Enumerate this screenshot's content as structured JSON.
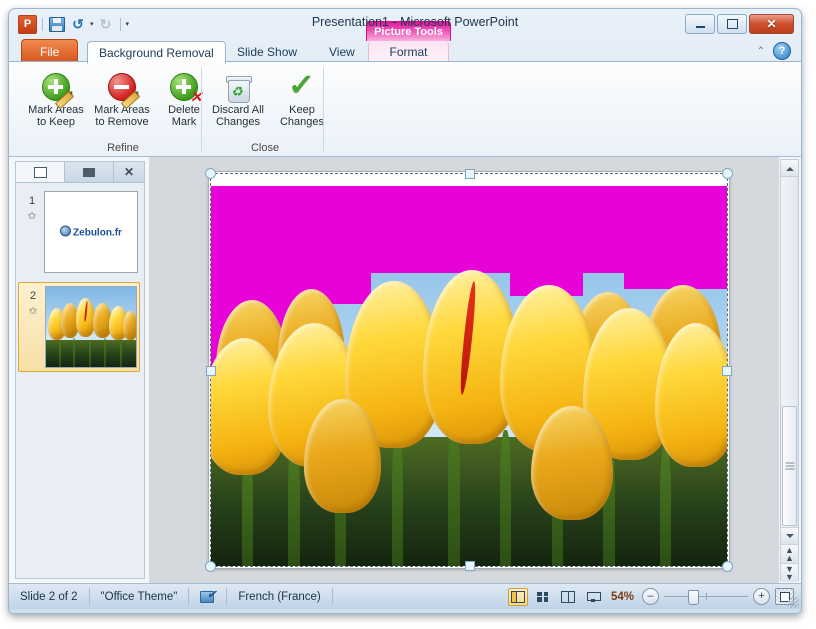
{
  "window": {
    "title": "Presentation1  -  Microsoft PowerPoint",
    "contextual_tab": "Picture Tools",
    "minimize": "–",
    "maximize": "□",
    "close": "✕"
  },
  "quick_access": {
    "app_logo": "P",
    "save": "save-icon",
    "undo": "↺",
    "undo_dropdown": "▾",
    "redo": "↻",
    "customize": "▾"
  },
  "help": {
    "collapse_ribbon": "⌃",
    "help": "?"
  },
  "tabs": [
    {
      "label": "File",
      "active": false
    },
    {
      "label": "Background Removal",
      "active": true
    },
    {
      "label": "Slide Show",
      "active": false
    },
    {
      "label": "View",
      "active": false
    },
    {
      "label": "Format",
      "active": false
    }
  ],
  "ribbon": {
    "groups": [
      {
        "label": "Refine",
        "buttons": [
          {
            "label_line1": "Mark Areas",
            "label_line2": "to Keep",
            "icon": "mark-keep-icon"
          },
          {
            "label_line1": "Mark Areas",
            "label_line2": "to Remove",
            "icon": "mark-remove-icon"
          },
          {
            "label_line1": "Delete",
            "label_line2": "Mark",
            "icon": "delete-mark-icon"
          }
        ]
      },
      {
        "label": "Close",
        "buttons": [
          {
            "label_line1": "Discard All",
            "label_line2": "Changes",
            "icon": "recycle-bin-icon"
          },
          {
            "label_line1": "Keep",
            "label_line2": "Changes",
            "icon": "checkmark-icon"
          }
        ]
      }
    ]
  },
  "slide_pane": {
    "tab_slides": "slides-tab-icon",
    "tab_outline": "outline-tab-icon",
    "close": "✕",
    "slides": [
      {
        "number": "1",
        "star": "✩",
        "selected": false,
        "content": "Zebulon.fr"
      },
      {
        "number": "2",
        "star": "✩",
        "selected": true,
        "content": "tulips-image"
      }
    ]
  },
  "canvas": {
    "selection": "picture-selected",
    "removal_color": "#e602d9"
  },
  "scrollbar": {
    "up": "▲",
    "down": "▼",
    "previous_slide": "▲",
    "next_slide": "▼"
  },
  "status": {
    "slide_counter": "Slide 2 of 2",
    "theme": "\"Office Theme\"",
    "spellcheck": "spellcheck-icon",
    "language": "French (France)",
    "views": [
      {
        "name": "Normal",
        "active": true
      },
      {
        "name": "Slide Sorter",
        "active": false
      },
      {
        "name": "Reading View",
        "active": false
      },
      {
        "name": "Slide Show",
        "active": false
      }
    ],
    "zoom_level": "54%",
    "zoom_out": "–",
    "zoom_in": "+",
    "fit_to_window": "fit-slide-icon"
  }
}
